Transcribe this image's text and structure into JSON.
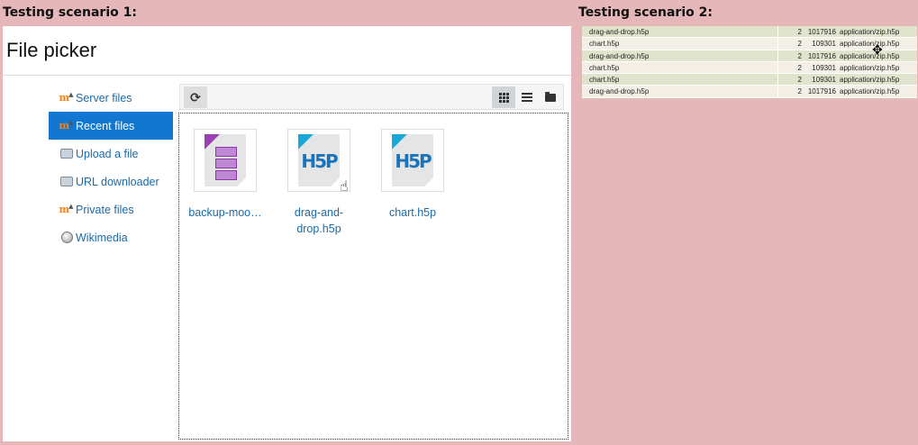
{
  "scenario1": {
    "label": "Testing scenario 1:"
  },
  "scenario2": {
    "label": "Testing scenario 2:"
  },
  "picker": {
    "title": "File picker",
    "sidebar": [
      {
        "label": "Server files",
        "icon": "moodle-icon"
      },
      {
        "label": "Recent files",
        "icon": "moodle-icon",
        "active": true
      },
      {
        "label": "Upload a file",
        "icon": "upload-icon"
      },
      {
        "label": "URL downloader",
        "icon": "upload-icon"
      },
      {
        "label": "Private files",
        "icon": "moodle-icon"
      },
      {
        "label": "Wikimedia",
        "icon": "wikimedia-icon"
      }
    ],
    "toolbar": {
      "refresh": "refresh-icon",
      "views": [
        "grid-icon",
        "list-icon",
        "folder-icon"
      ]
    },
    "files": [
      {
        "name": "backup-moo…",
        "icon": "backup-file-icon"
      },
      {
        "name": "drag-and-drop.h5p",
        "icon": "h5p-file-icon"
      },
      {
        "name": "chart.h5p",
        "icon": "h5p-file-icon"
      }
    ]
  },
  "table": {
    "rows": [
      {
        "name": "drag-and-drop.h5p",
        "count": "2",
        "size": "1017916",
        "type": "application/zip.h5p"
      },
      {
        "name": "chart.h5p",
        "count": "2",
        "size": "109301",
        "type": "application/zip.h5p"
      },
      {
        "name": "drag-and-drop.h5p",
        "count": "2",
        "size": "1017916",
        "type": "application/zip.h5p"
      },
      {
        "name": "chart.h5p",
        "count": "2",
        "size": "109301",
        "type": "application/zip.h5p"
      },
      {
        "name": "chart.h5p",
        "count": "2",
        "size": "109301",
        "type": "application/zip.h5p"
      },
      {
        "name": "drag-and-drop.h5p",
        "count": "2",
        "size": "1017916",
        "type": "application/zip.h5p"
      }
    ]
  },
  "colors": {
    "background": "#e6b7b8",
    "accent": "#1177d1",
    "link": "#1a6aa8"
  }
}
